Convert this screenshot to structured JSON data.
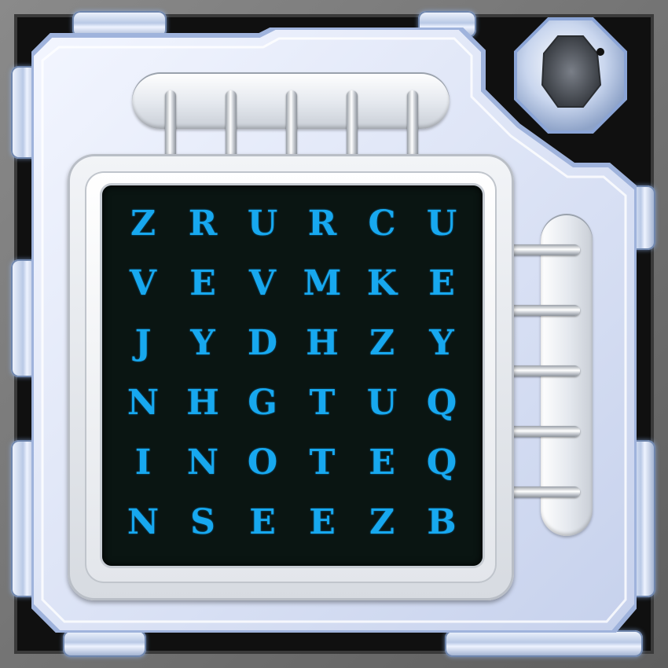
{
  "grid": {
    "rows": [
      [
        "Z",
        "R",
        "U",
        "R",
        "C",
        "U"
      ],
      [
        "V",
        "E",
        "V",
        "M",
        "K",
        "E"
      ],
      [
        "J",
        "Y",
        "D",
        "H",
        "Z",
        "Y"
      ],
      [
        "N",
        "H",
        "G",
        "T",
        "U",
        "Q"
      ],
      [
        "I",
        "N",
        "O",
        "T",
        "E",
        "Q"
      ],
      [
        "N",
        "S",
        "E",
        "E",
        "Z",
        "B"
      ]
    ]
  },
  "colors": {
    "letter": "#17a8ef",
    "board": "#0a1512",
    "device_shell": "#dfe6f7",
    "frame": "#6f6f6f"
  },
  "icons": {
    "knob": "spindle-knob-icon",
    "binding": "binder-ring-icon"
  }
}
